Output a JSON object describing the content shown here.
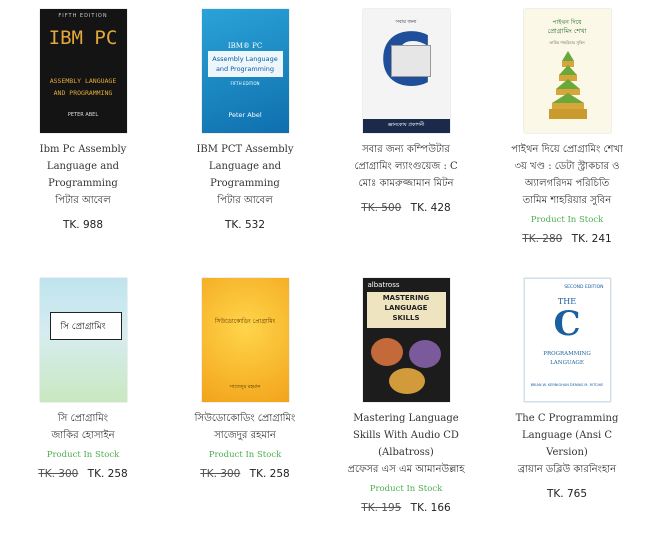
{
  "products": [
    {
      "title_lines": [
        "Ibm Pc Assembly",
        "Language and",
        "Programming"
      ],
      "author": "পিটার আবেল",
      "stock": "",
      "old_price": "",
      "price": "TK. 988",
      "cover": {
        "edition": "FIFTH EDITION",
        "big": "IBM PC",
        "sub1": "ASSEMBLY LANGUAGE",
        "sub2": "AND PROGRAMMING",
        "author": "PETER ABEL"
      }
    },
    {
      "title_lines": [
        "IBM PCT Assembly",
        "Language and",
        "Programming"
      ],
      "author": "পিটার আবেল",
      "stock": "",
      "old_price": "",
      "price": "TK. 532",
      "cover": {
        "line1": "IBM® PC",
        "line2": "Assembly Language",
        "line3": "and Programming",
        "edition": "FIFTH EDITION",
        "author": "Peter Abel"
      }
    },
    {
      "title_lines": [
        "সবার জন্য কম্পিউটার",
        "প্রোগ্রামিং ল্যাংগুয়েজ : C"
      ],
      "author": "মোঃ কামরুজ্জামান মিটন",
      "stock": "",
      "old_price": "TK. 500",
      "price": "TK. 428",
      "cover": {
        "top": "সবার জন্য",
        "big": "C",
        "footer": "জ্ঞানকোষ প্রকাশনী"
      }
    },
    {
      "title_lines": [
        "পাইথন দিয়ে প্রোগ্রামিং শেখা",
        "৩য় খণ্ড : ডেটা স্ট্রাকচার ও",
        "অ্যালগরিদম পরিচিতি"
      ],
      "author": "তামিম শাহরিয়ার সুবিন",
      "stock": "Product In Stock",
      "old_price": "TK. 280",
      "price": "TK. 241",
      "cover": {
        "top1": "পাইথন দিয়ে",
        "top2": "প্রোগ্রামিং শেখা",
        "top3": "তামিম শাহরিয়ার সুবিন"
      }
    },
    {
      "title_lines": [
        "সি প্রোগ্রামিং"
      ],
      "author": "জাকির হোসাইন",
      "stock": "Product In Stock",
      "old_price": "TK. 300",
      "price": "TK. 258",
      "cover": {
        "big": "সি প্রোগ্রামিং"
      }
    },
    {
      "title_lines": [
        "সিউডোকোডিং প্রোগ্রামিং"
      ],
      "author": "সাজেদুর রহমান",
      "stock": "Product In Stock",
      "old_price": "TK. 300",
      "price": "TK. 258",
      "cover": {
        "top": "সিউডোকোডিং প্রোগ্রামিং",
        "bottom": "সাজেদুর রহমান"
      }
    },
    {
      "title_lines": [
        "Mastering Language",
        "Skills With Audio CD",
        "(Albatross)"
      ],
      "author": "প্রফেসর এস এম আমানউল্লাহ",
      "stock": "Product In Stock",
      "old_price": "TK. 195",
      "price": "TK. 166",
      "cover": {
        "brand": "albatross",
        "line1": "MASTERING",
        "line2": "LANGUAGE",
        "line3": "SKILLS"
      }
    },
    {
      "title_lines": [
        "The C Programming",
        "Language (Ansi C",
        "Version)"
      ],
      "author": "ব্রায়ান ডব্লিউ কারনিংহান",
      "stock": "",
      "old_price": "",
      "price": "TK. 765",
      "cover": {
        "edition": "SECOND EDITION",
        "the": "THE",
        "c": "C",
        "line1": "PROGRAMMING",
        "line2": "LANGUAGE",
        "authors": "BRIAN W. KERNIGHAN  DENNIS M. RITCHIE"
      }
    }
  ],
  "colors": {
    "stock": "#4caf50",
    "text": "#333333"
  }
}
